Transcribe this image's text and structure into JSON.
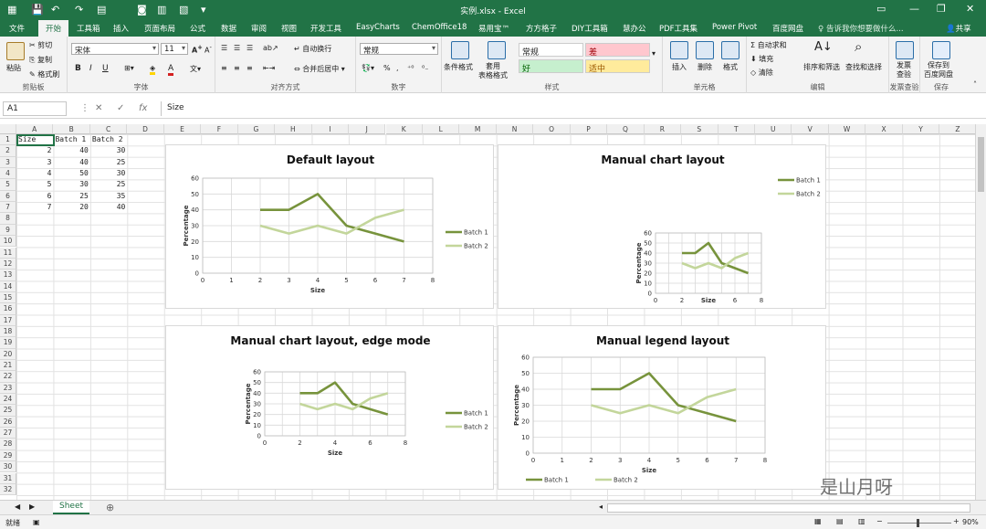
{
  "window": {
    "title": "实例.xlsx - Excel",
    "controls": {
      "min": "—",
      "restore": "❐",
      "close": "✕"
    }
  },
  "ribbon_tabs": [
    "文件",
    "开始",
    "工具箱",
    "插入",
    "页面布局",
    "公式",
    "数据",
    "审阅",
    "视图",
    "开发工具",
    "EasyCharts",
    "ChemOffice18",
    "易用宝™",
    "方方格子",
    "DIY工具箱",
    "慧办公",
    "PDF工具集",
    "Power Pivot",
    "百度网盘"
  ],
  "active_tab": "开始",
  "tell_me": "告诉我你想要做什么...",
  "share": "共享",
  "ribbon": {
    "clipboard": {
      "paste": "粘贴",
      "cut": "剪切",
      "copy": "复制",
      "format_painter": "格式刷",
      "label": "剪贴板"
    },
    "font": {
      "name": "宋体",
      "size": "11",
      "bold": "B",
      "italic": "I",
      "underline": "U",
      "font_color_glyph": "A",
      "label": "字体"
    },
    "alignment": {
      "wrap": "自动换行",
      "merge": "合并后居中",
      "label": "对齐方式"
    },
    "number": {
      "format": "常规",
      "percent": "%",
      "comma": ",",
      "label": "数字"
    },
    "styles": {
      "conditional": "条件格式",
      "table_format": "套用\n表格格式",
      "normal": "常规",
      "bad": "差",
      "good": "好",
      "neutral": "适中",
      "label": "样式"
    },
    "cells": {
      "insert": "插入",
      "delete": "删除",
      "format": "格式",
      "label": "单元格"
    },
    "editing": {
      "autosum": "自动求和",
      "fill": "填充",
      "clear": "清除",
      "sort": "排序和筛选",
      "find": "查找和选择",
      "label": "编辑"
    },
    "invoice": {
      "check": "发票\n查验",
      "label": "发票查验"
    },
    "save": {
      "save": "保存到\n百度网盘",
      "label": "保存"
    }
  },
  "formula_bar": {
    "name_box": "A1",
    "fx": "fx",
    "value": "Size"
  },
  "columns": [
    "A",
    "B",
    "C",
    "D",
    "E",
    "F",
    "G",
    "H",
    "I",
    "J",
    "K",
    "L",
    "M",
    "N",
    "O",
    "P",
    "Q",
    "R",
    "S",
    "T",
    "U",
    "V",
    "W",
    "X",
    "Y",
    "Z"
  ],
  "rows": [
    "1",
    "2",
    "3",
    "4",
    "5",
    "6",
    "7",
    "8",
    "9",
    "10",
    "11",
    "12",
    "13",
    "14",
    "15",
    "16",
    "17",
    "18",
    "19",
    "20",
    "21",
    "22",
    "23",
    "24",
    "25",
    "26",
    "27",
    "28",
    "29",
    "30",
    "31",
    "32"
  ],
  "table": {
    "headers": [
      "Size",
      "Batch 1",
      "Batch 2"
    ],
    "rows": [
      [
        2,
        40,
        30
      ],
      [
        3,
        40,
        25
      ],
      [
        4,
        50,
        30
      ],
      [
        5,
        30,
        25
      ],
      [
        6,
        25,
        35
      ],
      [
        7,
        20,
        40
      ]
    ]
  },
  "chart_data": [
    {
      "type": "line",
      "title": "Default layout",
      "xlabel": "Size",
      "ylabel": "Percentage",
      "x": [
        2,
        3,
        4,
        5,
        6,
        7
      ],
      "xlim": [
        0,
        8
      ],
      "ylim": [
        0,
        60
      ],
      "series": [
        {
          "name": "Batch 1",
          "values": [
            40,
            40,
            50,
            30,
            25,
            20
          ],
          "color": "#77933c"
        },
        {
          "name": "Batch 2",
          "values": [
            30,
            25,
            30,
            25,
            35,
            40
          ],
          "color": "#c3d69b"
        }
      ],
      "legend": "right"
    },
    {
      "type": "line",
      "title": "Manual chart layout",
      "xlabel": "Size",
      "ylabel": "Percentage",
      "x": [
        2,
        3,
        4,
        5,
        6,
        7
      ],
      "xlim": [
        0,
        8
      ],
      "ylim": [
        0,
        60
      ],
      "series": [
        {
          "name": "Batch 1",
          "values": [
            40,
            40,
            50,
            30,
            25,
            20
          ],
          "color": "#77933c"
        },
        {
          "name": "Batch 2",
          "values": [
            30,
            25,
            30,
            25,
            35,
            40
          ],
          "color": "#c3d69b"
        }
      ],
      "legend": "top-right"
    },
    {
      "type": "line",
      "title": "Manual chart layout, edge mode",
      "xlabel": "Size",
      "ylabel": "Percentage",
      "x": [
        2,
        3,
        4,
        5,
        6,
        7
      ],
      "xlim": [
        0,
        8
      ],
      "ylim": [
        0,
        60
      ],
      "series": [
        {
          "name": "Batch 1",
          "values": [
            40,
            40,
            50,
            30,
            25,
            20
          ],
          "color": "#77933c"
        },
        {
          "name": "Batch 2",
          "values": [
            30,
            25,
            30,
            25,
            35,
            40
          ],
          "color": "#c3d69b"
        }
      ],
      "legend": "right"
    },
    {
      "type": "line",
      "title": "Manual legend layout",
      "xlabel": "Size",
      "ylabel": "Percentage",
      "x": [
        2,
        3,
        4,
        5,
        6,
        7
      ],
      "xlim": [
        0,
        8
      ],
      "ylim": [
        0,
        60
      ],
      "series": [
        {
          "name": "Batch 1",
          "values": [
            40,
            40,
            50,
            30,
            25,
            20
          ],
          "color": "#77933c"
        },
        {
          "name": "Batch 2",
          "values": [
            30,
            25,
            30,
            25,
            35,
            40
          ],
          "color": "#c3d69b"
        }
      ],
      "legend": "bottom-left"
    }
  ],
  "sheet_tabs": [
    "Sheet"
  ],
  "status": {
    "ready": "就绪",
    "zoom": "90%"
  },
  "watermark": "是山月呀"
}
